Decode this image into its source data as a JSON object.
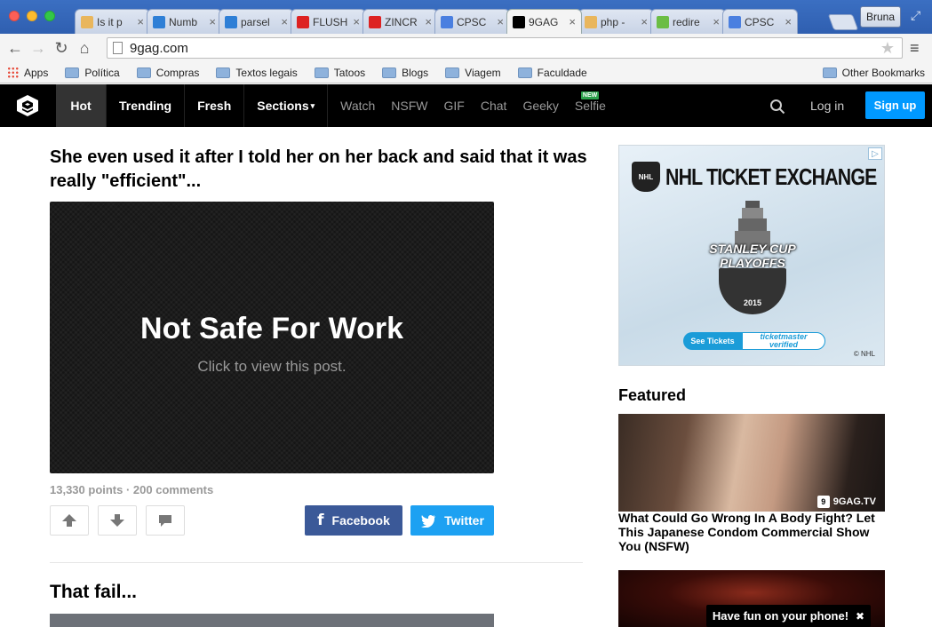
{
  "browser": {
    "tabs": [
      {
        "label": "Is it p",
        "color": "#e9b65c",
        "active": false
      },
      {
        "label": "Numb",
        "color": "#2e7fd6",
        "active": false
      },
      {
        "label": "parsel",
        "color": "#2e7fd6",
        "active": false
      },
      {
        "label": "FLUSH",
        "color": "#d22",
        "active": false
      },
      {
        "label": "ZINCR",
        "color": "#d22",
        "active": false
      },
      {
        "label": "CPSC",
        "color": "#4a7fe0",
        "active": false
      },
      {
        "label": "9GAG",
        "color": "#000000",
        "active": true
      },
      {
        "label": "php -",
        "color": "#e9b65c",
        "active": false
      },
      {
        "label": "redire",
        "color": "#6bbd44",
        "active": false
      },
      {
        "label": "CPSC",
        "color": "#4a7fe0",
        "active": false
      }
    ],
    "user": "Bruna",
    "url": "9gag.com",
    "bookmarks": [
      "Apps",
      "Política",
      "Compras",
      "Textos legais",
      "Tatoos",
      "Blogs",
      "Viagem",
      "Faculdade"
    ],
    "other_bookmarks": "Other Bookmarks"
  },
  "header": {
    "primary_nav": [
      "Hot",
      "Trending",
      "Fresh",
      "Sections"
    ],
    "secondary_nav": [
      "Watch",
      "NSFW",
      "GIF",
      "Chat",
      "Geeky",
      "Selfie"
    ],
    "new_badge": "NEW",
    "login": "Log in",
    "signup": "Sign up"
  },
  "post": {
    "title": "She even used it after I told her on her back and said that it was really \"efficient\"...",
    "nsfw_title": "Not Safe For Work",
    "nsfw_sub": "Click to view this post.",
    "meta": "13,330 points · 200 comments",
    "facebook": "Facebook",
    "twitter": "Twitter"
  },
  "post2": {
    "title": "That fail..."
  },
  "ad": {
    "headline": "NHL TICKET EXCHANGE",
    "playoffs_line1": "STANLEY CUP",
    "playoffs_line2": "PLAYOFFS",
    "year": "2015",
    "cta": "See Tickets",
    "brand_line1": "ticketmaster",
    "brand_line2": "verified",
    "shield": "NHL",
    "copyright": "© NHL"
  },
  "featured": {
    "title": "Featured",
    "watermark": "9GAG.TV",
    "caption": "What Could Go Wrong In A Body Fight? Let This Japanese Condom Commercial Show You (NSFW)"
  },
  "toast": {
    "text": "Have fun on your phone!"
  }
}
